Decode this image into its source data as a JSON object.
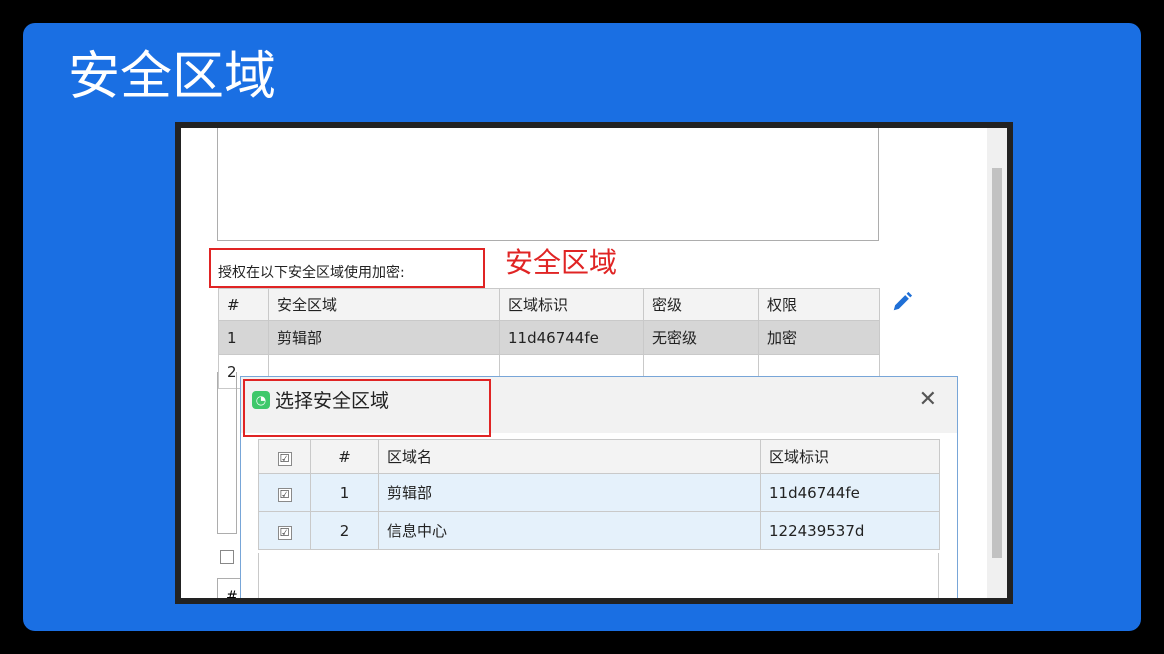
{
  "slide": {
    "title": "安全区域"
  },
  "form": {
    "auth_label": "授权在以下安全区域使用加密:",
    "annotation": "安全区域",
    "hidden_hash": "#"
  },
  "zone_table": {
    "headers": [
      "#",
      "安全区域",
      "区域标识",
      "密级",
      "权限"
    ],
    "rows": [
      [
        "1",
        "剪辑部",
        "11d46744fe",
        "无密级",
        "加密"
      ],
      [
        "2",
        "",
        "",
        "",
        ""
      ]
    ]
  },
  "dialog": {
    "title": "选择安全区域",
    "close_glyph": "✕",
    "headers": [
      "☑",
      "#",
      "区域名",
      "区域标识"
    ],
    "rows": [
      {
        "checked": "☑",
        "num": "1",
        "name": "剪辑部",
        "id": "11d46744fe"
      },
      {
        "checked": "☑",
        "num": "2",
        "name": "信息中心",
        "id": "122439537d"
      }
    ]
  },
  "colors": {
    "slide_bg": "#1a6fe3",
    "highlight_red": "#e02424",
    "edit_blue": "#1f6fd6"
  }
}
